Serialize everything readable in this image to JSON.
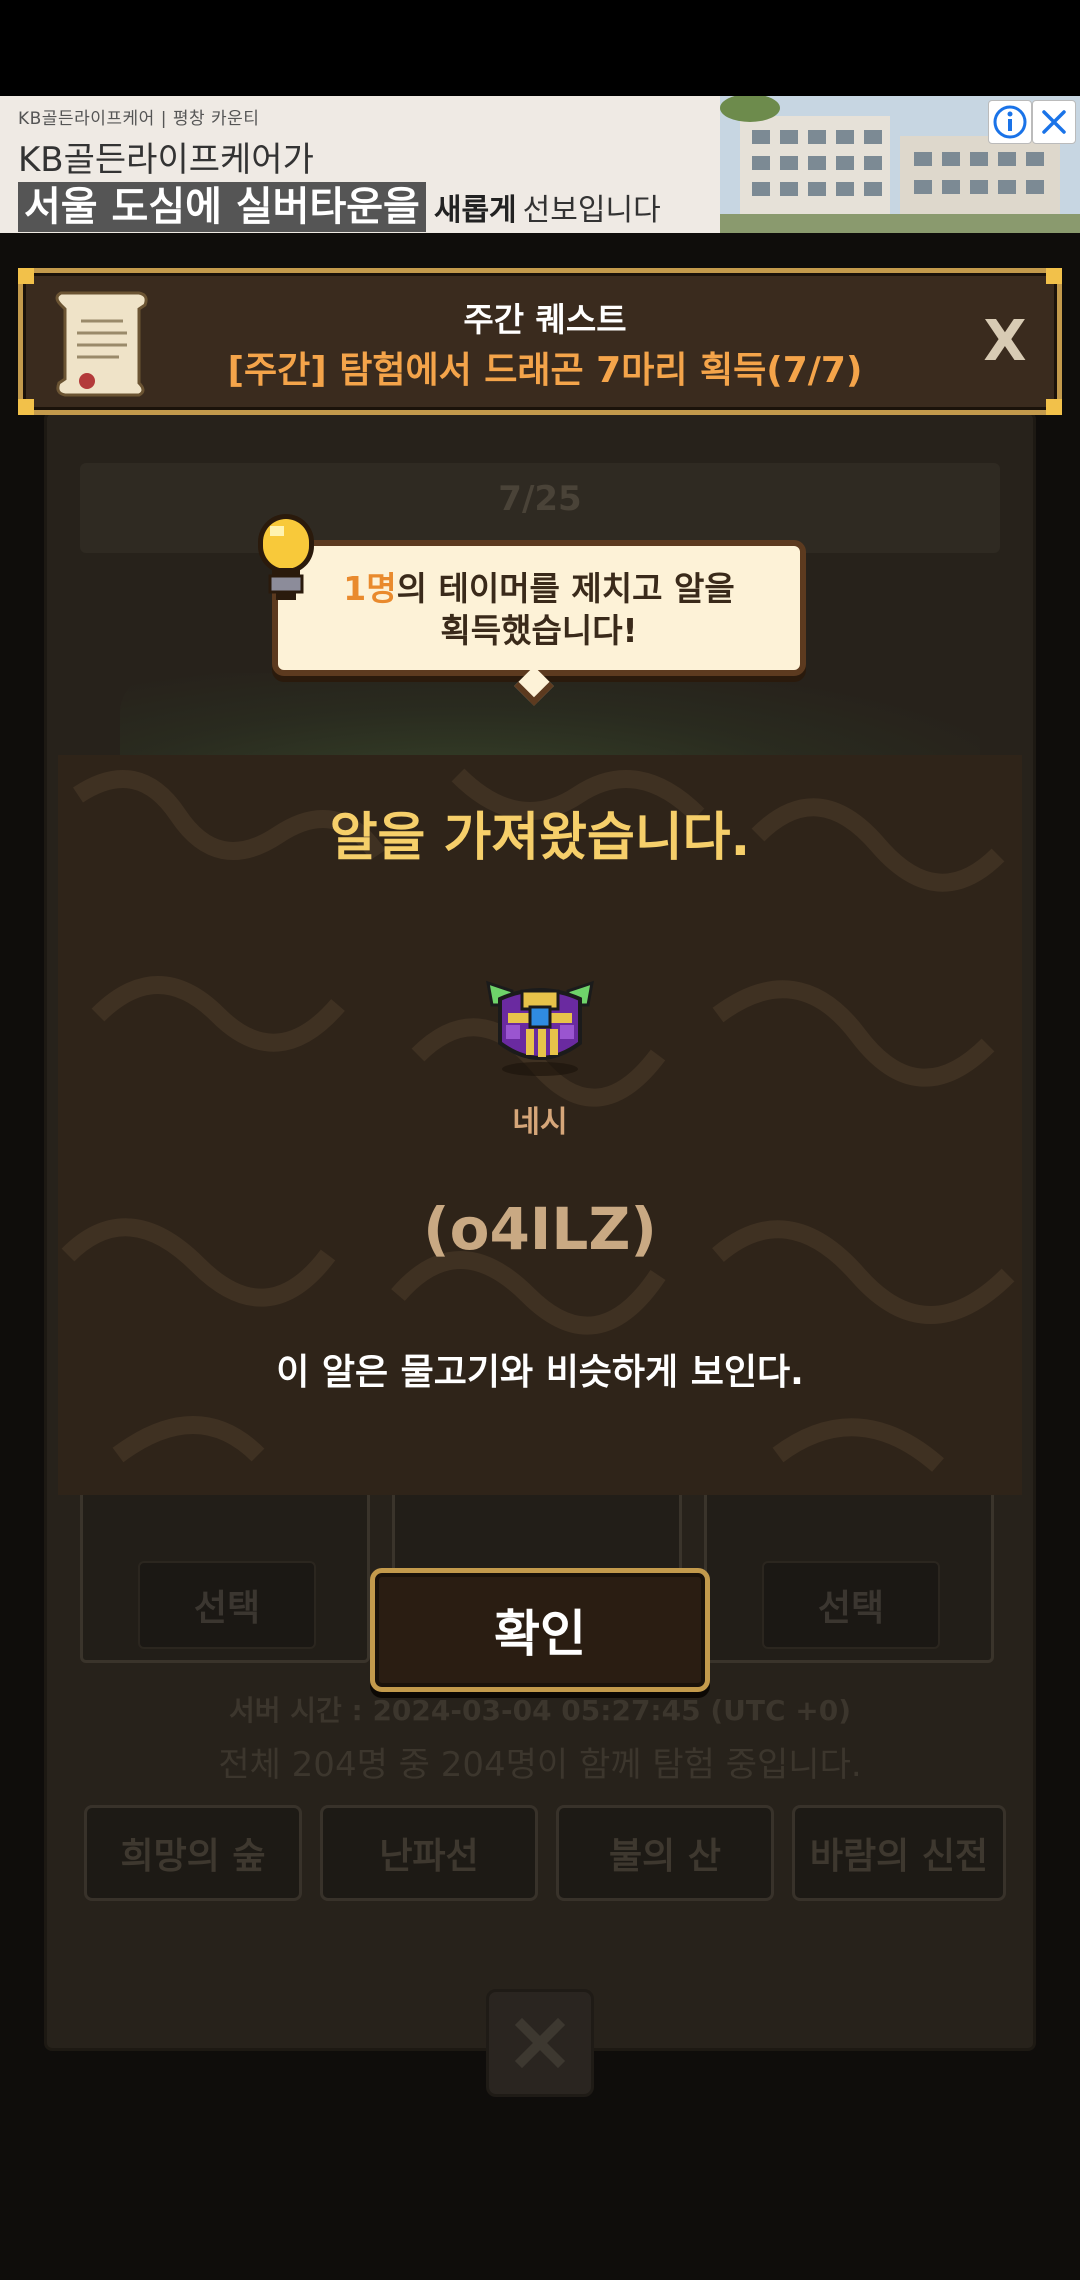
{
  "ad": {
    "brand_line": "KB골든라이프케어 | 평창 카운티",
    "headline_top": "KB골든라이프케어가",
    "headline_main": "서울 도심에 실버타운을",
    "headline_bold": "새롭게",
    "headline_rest": "선보입니다",
    "info_icon": "info-icon",
    "close_icon": "close-icon"
  },
  "quest": {
    "title": "주간 퀘스트",
    "description": "[주간] 탐험에서 드래곤 7마리 획득(7/7)",
    "close_label": "X"
  },
  "tooltip": {
    "count_highlight": "1명",
    "message_line1": "의 테이머를 제치고 알을",
    "message_line2": "획득했습니다!"
  },
  "modal": {
    "title": "알을 가져왔습니다.",
    "egg_name": "네시",
    "egg_code": "(o4ILZ)",
    "egg_description": "이 알은 물고기와 비슷하게 보인다."
  },
  "confirm_button": {
    "label": "확인"
  },
  "background": {
    "progress_text": "7/25",
    "select_label_left": "선택",
    "select_label_right": "선택",
    "server_time": "서버 시간 : 2024-03-04 05:27:45 (UTC +0)",
    "explore_status": "전체 204명 중 204명이 함께 탐험 중입니다.",
    "tabs": [
      "희망의 숲",
      "난파선",
      "불의 산",
      "바람의 신전"
    ]
  },
  "colors": {
    "accent_gold": "#f6cf6a",
    "quest_orange": "#f4a44a",
    "highlight_orange": "#e98a2d",
    "frame_gold": "#c39a4c"
  }
}
